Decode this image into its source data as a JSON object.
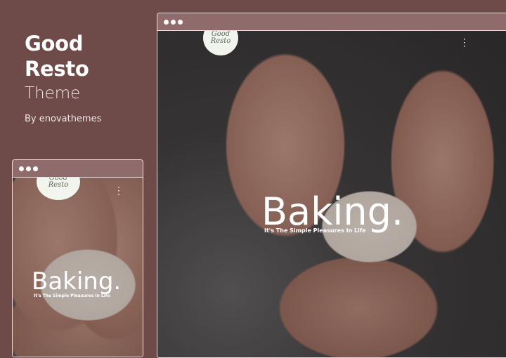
{
  "brand": {
    "title_line1": "Good",
    "title_line2": "Resto",
    "subtitle": "Theme",
    "author": "By enovathemes"
  },
  "hero": {
    "title": "Baking.",
    "tagline": "It's The Simple Pleasures In Life"
  },
  "logo": {
    "line1": "Good",
    "line2": "Resto"
  },
  "icons": {
    "menu": "kebab-menu-icon",
    "settings": "gear-icon"
  }
}
